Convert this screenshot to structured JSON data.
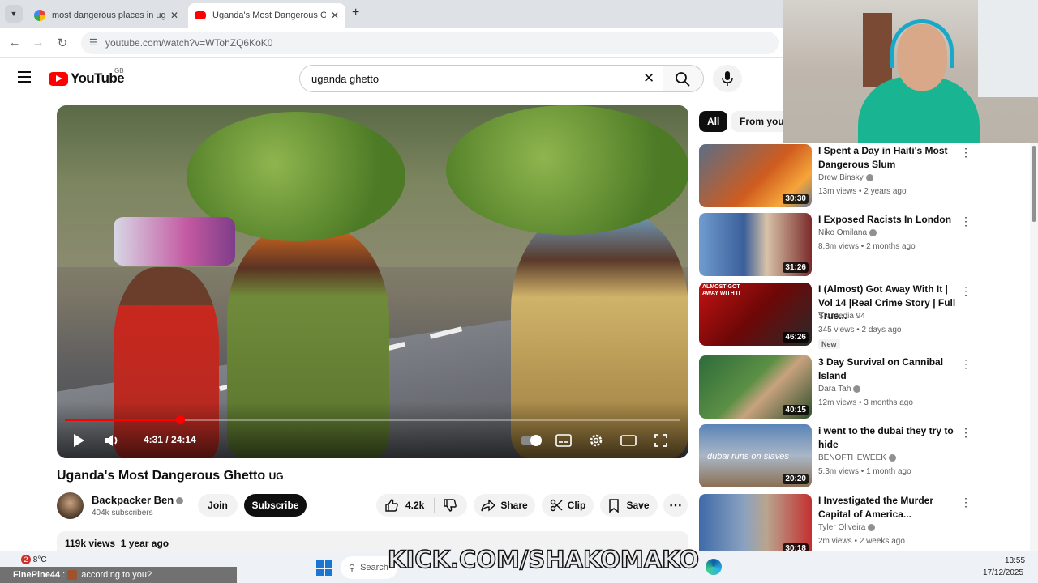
{
  "browser": {
    "tabs": [
      {
        "title": "most dangerous places in uga",
        "active": false,
        "favicon": "google-icon"
      },
      {
        "title": "Uganda's Most Dangerous Ghe",
        "active": true,
        "favicon": "youtube-icon"
      }
    ],
    "url": "youtube.com/watch?v=WTohZQ6KoK0"
  },
  "youtube": {
    "logo_text": "YouTube",
    "country_code": "GB",
    "search_value": "uganda ghetto"
  },
  "video": {
    "current_time": "4:31",
    "duration": "24:14",
    "time_display": "4:31 / 24:14",
    "progress_fraction": 0.187,
    "title": "Uganda's Most Dangerous Ghetto",
    "title_suffix": "UG",
    "channel": "Backpacker Ben",
    "subscribers": "404k subscribers",
    "join_label": "Join",
    "subscribe_label": "Subscribe",
    "likes": "4.2k",
    "share_label": "Share",
    "clip_label": "Clip",
    "save_label": "Save",
    "views": "119k views",
    "age": "1 year ago"
  },
  "chips": [
    "All",
    "From your"
  ],
  "recommendations": [
    {
      "title": "I Spent a Day in Haiti's Most Dangerous Slum",
      "channel": "Drew Binsky",
      "verified": true,
      "meta": "13m views • 2 years ago",
      "duration": "30:30",
      "is_new": false
    },
    {
      "title": "I Exposed Racists In London",
      "channel": "Niko Omilana",
      "verified": true,
      "meta": "8.8m views • 2 months ago",
      "duration": "31:26",
      "is_new": false
    },
    {
      "title": "I (Almost) Got Away With It | Vol 14 |Real Crime Story | Full True...",
      "channel": "SN Media 94",
      "verified": false,
      "meta": "345 views • 2 days ago",
      "duration": "46:26",
      "is_new": true,
      "badge": "New"
    },
    {
      "title": "3 Day Survival on Cannibal Island",
      "channel": "Dara Tah",
      "verified": true,
      "meta": "12m views • 3 months ago",
      "duration": "40:15",
      "is_new": false
    },
    {
      "title": "i went to the dubai they try to hide",
      "channel": "BENOFTHEWEEK",
      "verified": true,
      "meta": "5.3m views • 1 month ago",
      "duration": "20:20",
      "is_new": false
    },
    {
      "title": "I Investigated the Murder Capital of America...",
      "channel": "Tyler Oliveira",
      "verified": true,
      "meta": "2m views • 2 weeks ago",
      "duration": "30:18",
      "is_new": false
    }
  ],
  "thumb_text": {
    "rec3": "ALMOST GOT AWAY WITH IT",
    "rec5": "dubai runs on slaves"
  },
  "overlay": {
    "kick_text": "KICK.COM/SHAKOMAKO",
    "chat_user": "FinePine44",
    "chat_message": "according to you?"
  },
  "taskbar": {
    "weather_badge": "2",
    "temperature": "8°C",
    "search_placeholder": "Search",
    "time": "13:55",
    "date": "17/12/2025"
  }
}
